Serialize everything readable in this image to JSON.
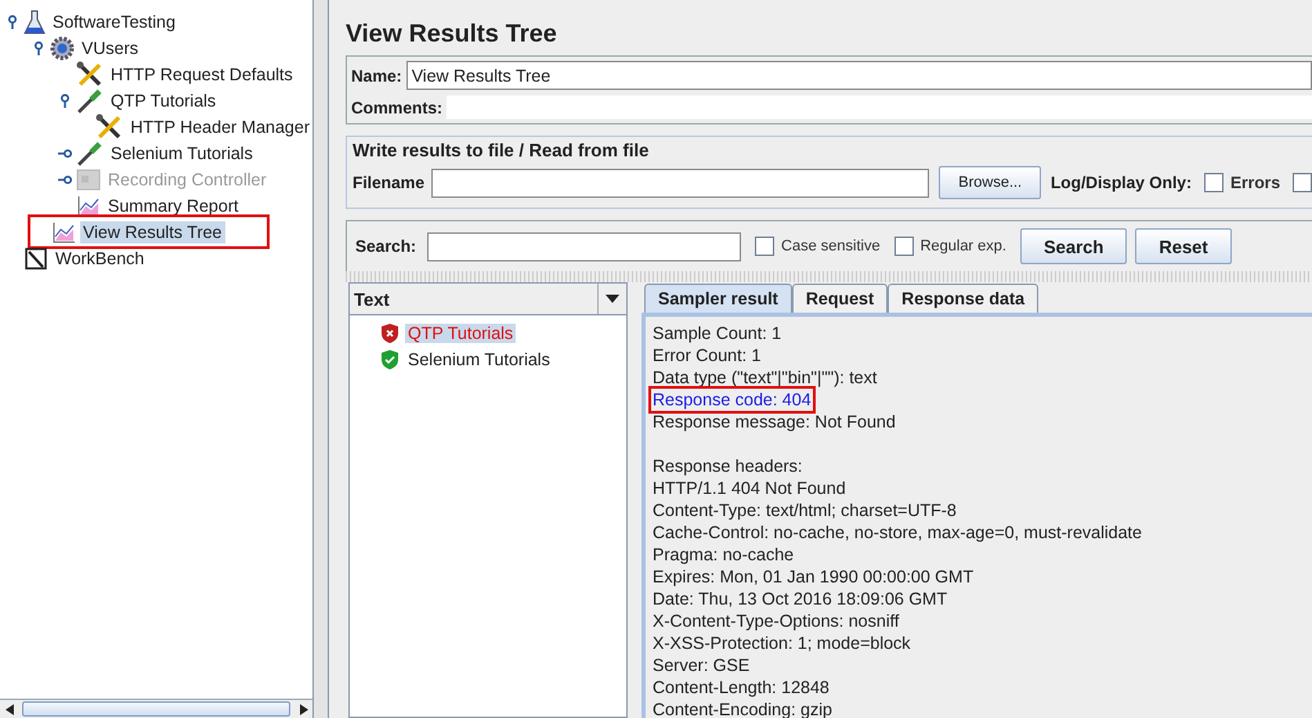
{
  "tree": [
    {
      "label": "SoftwareTesting",
      "kind": "test-plan",
      "expanded": true,
      "selected": false,
      "disabled": false,
      "children": [
        {
          "label": "VUsers",
          "kind": "thread-group",
          "expanded": true,
          "selected": false,
          "disabled": false,
          "children": [
            {
              "label": "HTTP Request Defaults",
              "kind": "config",
              "selected": false,
              "disabled": false
            },
            {
              "label": "QTP Tutorials",
              "kind": "sampler",
              "expanded": true,
              "selected": false,
              "disabled": false,
              "children": [
                {
                  "label": "HTTP Header Manager",
                  "kind": "config",
                  "selected": false,
                  "disabled": false
                }
              ]
            },
            {
              "label": "Selenium Tutorials",
              "kind": "sampler",
              "expanded": false,
              "selected": false,
              "disabled": false
            },
            {
              "label": "Recording Controller",
              "kind": "controller",
              "expanded": false,
              "selected": false,
              "disabled": true
            },
            {
              "label": "Summary Report",
              "kind": "listener",
              "selected": false,
              "disabled": false
            },
            {
              "label": "View Results Tree",
              "kind": "listener",
              "selected": true,
              "disabled": false,
              "annotated": true
            }
          ]
        }
      ]
    },
    {
      "label": "WorkBench",
      "kind": "workbench",
      "selected": false,
      "disabled": false
    }
  ],
  "panel": {
    "title": "View Results Tree",
    "name_label": "Name:",
    "name_value": "View Results Tree",
    "comments_label": "Comments:",
    "file_group": {
      "title": "Write results to file / Read from file",
      "filename_label": "Filename",
      "browse": "Browse...",
      "log_label": "Log/Display Only:",
      "checkboxes": [
        {
          "label": "Errors",
          "checked": false
        },
        {
          "checked": false
        }
      ]
    },
    "search": {
      "label": "Search:",
      "options": [
        {
          "label": "Case sensitive",
          "checked": false
        },
        {
          "label": "Regular exp.",
          "checked": false
        }
      ],
      "buttons": [
        "Search",
        "Reset"
      ]
    },
    "results": {
      "renderer": "Text",
      "items": [
        {
          "label": "QTP Tutorials",
          "failed": true,
          "selected": true
        },
        {
          "label": "Selenium Tutorials",
          "failed": false,
          "selected": false
        }
      ]
    },
    "tabs": [
      {
        "label": "Sampler result",
        "selected": true
      },
      {
        "label": "Request",
        "selected": false
      },
      {
        "label": "Response data",
        "selected": false
      }
    ],
    "sections": [
      [
        {
          "text": "Sample Count: 1",
          "kind": "plain"
        },
        {
          "text": "Error Count: 1",
          "kind": "plain"
        },
        {
          "text": "Data type (\"text\"|\"bin\"|\"\"): text",
          "kind": "plain"
        },
        {
          "text": "Response code: 404",
          "kind": "code",
          "annotated": true
        },
        {
          "text": "Response message: Not Found",
          "kind": "plain"
        }
      ],
      [
        {
          "text": "Response headers:",
          "kind": "plain"
        },
        {
          "text": "HTTP/1.1 404 Not Found",
          "kind": "plain"
        },
        {
          "text": "Content-Type: text/html; charset=UTF-8",
          "kind": "plain"
        },
        {
          "text": "Cache-Control: no-cache, no-store, max-age=0, must-revalidate",
          "kind": "plain"
        },
        {
          "text": "Pragma: no-cache",
          "kind": "plain"
        },
        {
          "text": "Expires: Mon, 01 Jan 1990 00:00:00 GMT",
          "kind": "plain"
        },
        {
          "text": "Date: Thu, 13 Oct 2016 18:09:06 GMT",
          "kind": "plain"
        },
        {
          "text": "X-Content-Type-Options: nosniff",
          "kind": "plain"
        },
        {
          "text": "X-XSS-Protection: 1; mode=block",
          "kind": "plain"
        },
        {
          "text": "Server: GSE",
          "kind": "plain"
        },
        {
          "text": "Content-Length: 12848",
          "kind": "plain"
        },
        {
          "text": "Content-Encoding: gzip",
          "kind": "plain"
        }
      ]
    ]
  }
}
